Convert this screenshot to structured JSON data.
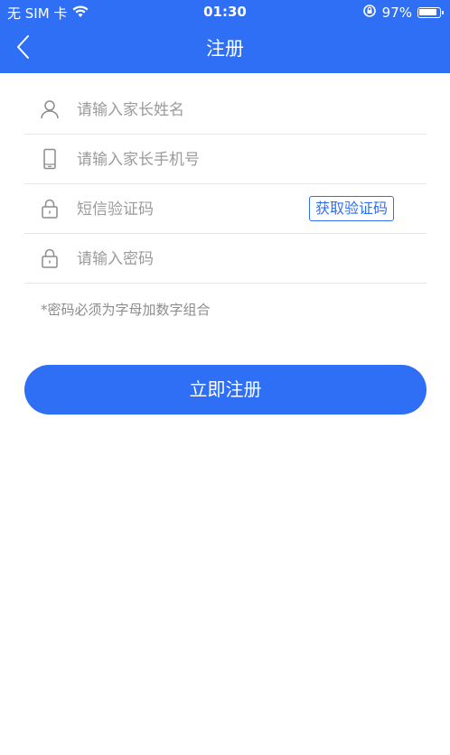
{
  "status_bar": {
    "carrier": "无 SIM 卡",
    "time": "01:30",
    "battery": "97%",
    "battery_level": 0.97
  },
  "nav": {
    "title": "注册"
  },
  "form": {
    "parent_name_placeholder": "请输入家长姓名",
    "parent_phone_placeholder": "请输入家长手机号",
    "sms_code_placeholder": "短信验证码",
    "get_code_label": "获取验证码",
    "password_placeholder": "请输入密码",
    "password_hint": "*密码必须为字母加数字组合",
    "submit_label": "立即注册"
  },
  "colors": {
    "primary": "#2f6ff6",
    "divider": "#e6e6e6",
    "placeholder": "#9b9b9b"
  }
}
